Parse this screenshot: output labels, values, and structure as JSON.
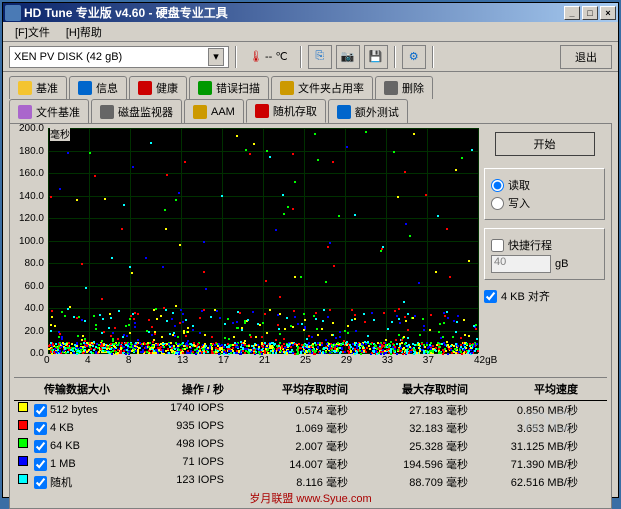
{
  "window": {
    "title": "HD Tune 专业版 v4.60 - 硬盘专业工具"
  },
  "menu": {
    "file": "[F]文件",
    "help": "[H]帮助"
  },
  "toolbar": {
    "disk": "XEN  PV DISK       (42 gB)",
    "temp_unit": "-- ℃",
    "exit": "退出"
  },
  "tabs1": [
    {
      "label": "基准",
      "icon": "#f4c430"
    },
    {
      "label": "信息",
      "icon": "#0066cc"
    },
    {
      "label": "健康",
      "icon": "#cc0000"
    },
    {
      "label": "错误扫描",
      "icon": "#009900"
    },
    {
      "label": "文件夹占用率",
      "icon": "#cc9900"
    },
    {
      "label": "删除",
      "icon": "#666"
    }
  ],
  "tabs2": [
    {
      "label": "文件基准",
      "icon": "#aa66cc"
    },
    {
      "label": "磁盘监视器",
      "icon": "#666"
    },
    {
      "label": "AAM",
      "icon": "#cc9900"
    },
    {
      "label": "随机存取",
      "icon": "#cc0000",
      "active": true
    },
    {
      "label": "额外测试",
      "icon": "#0066cc"
    }
  ],
  "chart_data": {
    "type": "scatter",
    "title": "毫秒",
    "ylabel": "毫秒",
    "ylim": [
      0,
      200
    ],
    "yticks": [
      0,
      20,
      40,
      60,
      80,
      100,
      120,
      140,
      160,
      180,
      200
    ],
    "xlabel": "",
    "xlim": [
      0,
      42
    ],
    "xticks": [
      0,
      4,
      8,
      13,
      17,
      21,
      25,
      29,
      33,
      37,
      42
    ],
    "xunit": "gB",
    "note": "5 color series of random-access latency scatter; most points clustered 0–15ms across full 42gB span, sparse outliers up to ~200ms"
  },
  "side": {
    "start": "开始",
    "read": "读取",
    "write": "写入",
    "fast": "快捷行程",
    "fast_val": "40",
    "fast_unit": "gB",
    "align": "4 KB 对齐"
  },
  "results": {
    "headers": [
      "传输数据大小",
      "操作 / 秒",
      "平均存取时间",
      "最大存取时间",
      "平均速度"
    ],
    "rows": [
      {
        "color": "#ffff00",
        "label": "512 bytes",
        "iops": "1740 IOPS",
        "avg": "0.574 毫秒",
        "max": "27.183 毫秒",
        "speed": "0.850 MB/秒"
      },
      {
        "color": "#ff0000",
        "label": "4 KB",
        "iops": "935 IOPS",
        "avg": "1.069 毫秒",
        "max": "32.183 毫秒",
        "speed": "3.653 MB/秒"
      },
      {
        "color": "#00ff00",
        "label": "64 KB",
        "iops": "498 IOPS",
        "avg": "2.007 毫秒",
        "max": "25.328 毫秒",
        "speed": "31.125 MB/秒"
      },
      {
        "color": "#0000ff",
        "label": "1 MB",
        "iops": "71 IOPS",
        "avg": "14.007 毫秒",
        "max": "194.596 毫秒",
        "speed": "71.390 MB/秒"
      },
      {
        "color": "#00ffff",
        "label": "随机",
        "iops": "123 IOPS",
        "avg": "8.116 毫秒",
        "max": "88.709 毫秒",
        "speed": "62.516 MB/秒"
      }
    ]
  },
  "watermark": "岁月联盟  www.Syue.com",
  "idc": "IDC"
}
